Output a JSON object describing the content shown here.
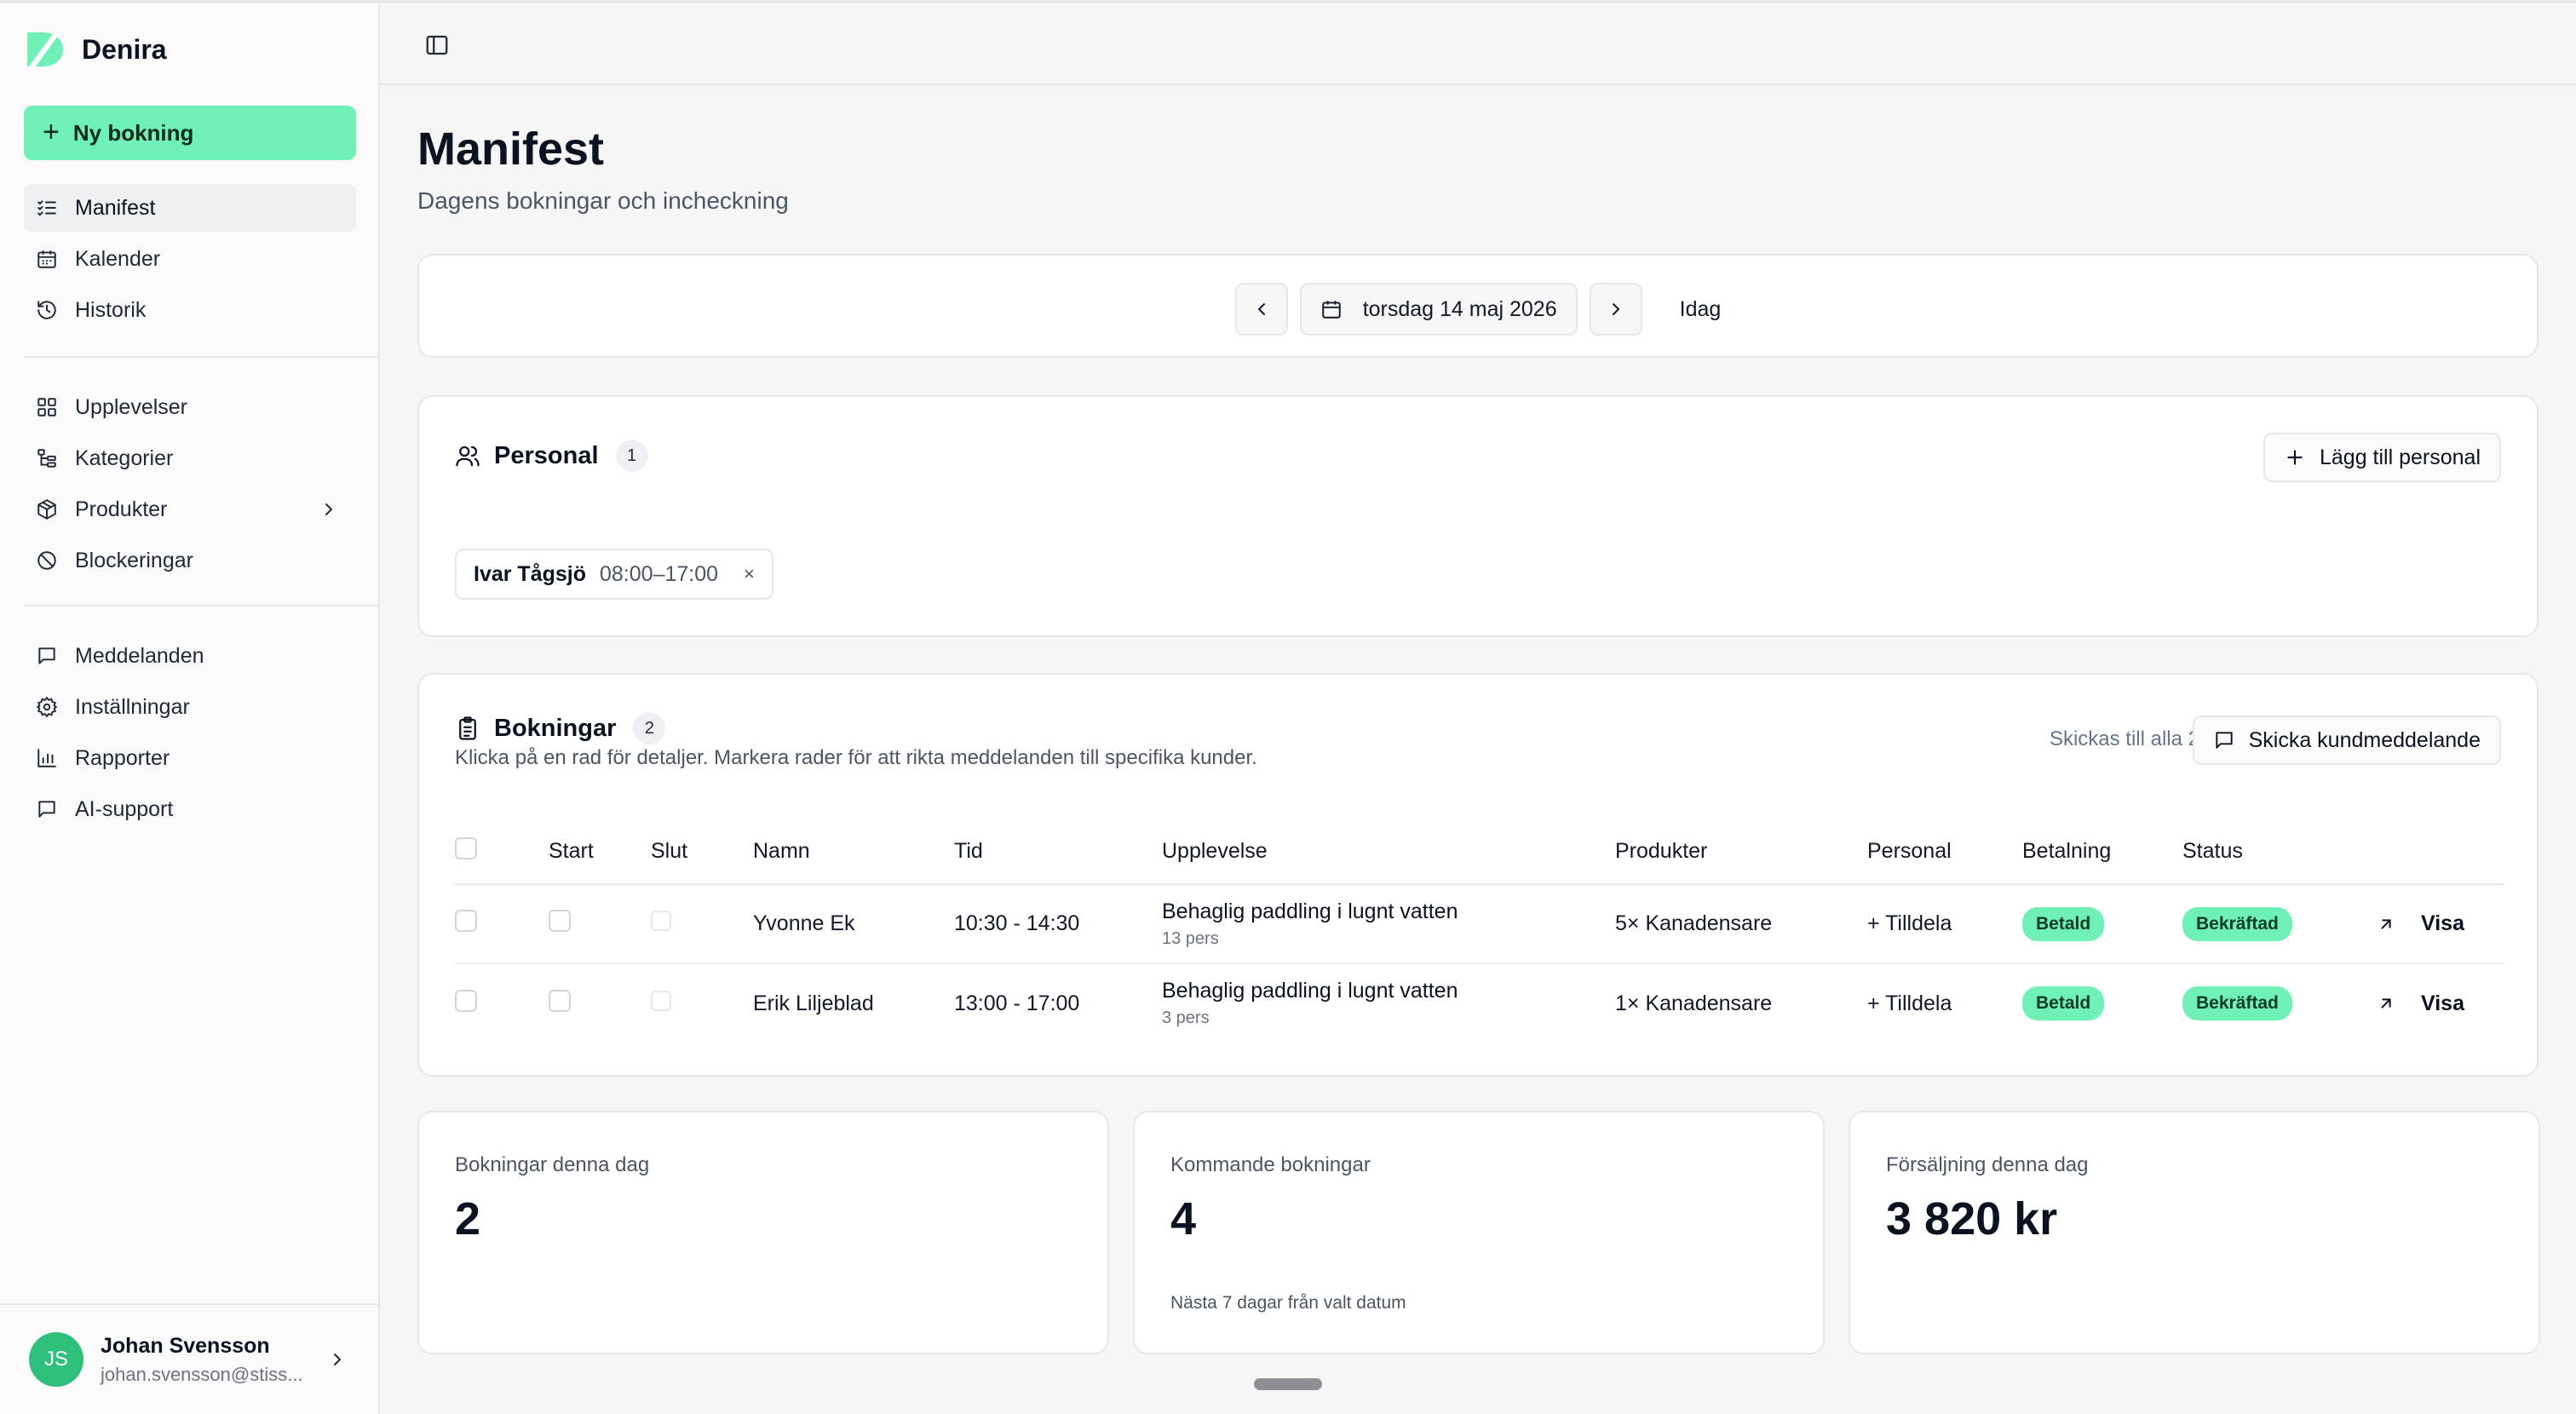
{
  "app": {
    "brand": "Denira",
    "accent": "#6ef0b6"
  },
  "sidebar": {
    "new_booking": "Ny bokning",
    "groups": [
      [
        {
          "label": "Manifest",
          "icon": "list-check-icon",
          "active": true
        },
        {
          "label": "Kalender",
          "icon": "calendar-icon"
        },
        {
          "label": "Historik",
          "icon": "history-icon"
        }
      ],
      [
        {
          "label": "Upplevelser",
          "icon": "grid-icon"
        },
        {
          "label": "Kategorier",
          "icon": "tree-icon"
        },
        {
          "label": "Produkter",
          "icon": "box-icon",
          "has_children": true
        },
        {
          "label": "Blockeringar",
          "icon": "ban-icon"
        }
      ],
      [
        {
          "label": "Meddelanden",
          "icon": "message-icon"
        },
        {
          "label": "Inställningar",
          "icon": "gear-icon"
        },
        {
          "label": "Rapporter",
          "icon": "bar-chart-icon"
        },
        {
          "label": "AI-support",
          "icon": "message-icon"
        }
      ]
    ],
    "user": {
      "initials": "JS",
      "name": "Johan Svensson",
      "email": "johan.svensson@stiss..."
    }
  },
  "page": {
    "title": "Manifest",
    "subtitle": "Dagens bokningar och incheckning"
  },
  "date_nav": {
    "date": "torsdag 14 maj 2026",
    "today": "Idag"
  },
  "staff": {
    "title": "Personal",
    "count": "1",
    "add_label": "Lägg till personal",
    "chips": [
      {
        "name": "Ivar Tågsjö",
        "time": "08:00–17:00",
        "remove": "×"
      }
    ]
  },
  "bookings": {
    "title": "Bokningar",
    "count": "2",
    "description": "Klicka på en rad för detaljer. Markera rader för att rikta meddelanden till specifika kunder.",
    "send_to": "Skickas till alla 2",
    "send_label": "Skicka kundmeddelande",
    "columns": [
      "Start",
      "Slut",
      "Namn",
      "Tid",
      "Upplevelse",
      "Produkter",
      "Personal",
      "Betalning",
      "Status"
    ],
    "rows": [
      {
        "name": "Yvonne Ek",
        "time": "10:30 - 14:30",
        "experience": "Behaglig paddling i lugnt vatten",
        "people": "13 pers",
        "products": "5× Kanadensare",
        "staff": "+ Tilldela",
        "payment": "Betald",
        "status": "Bekräftad",
        "action": "Visa"
      },
      {
        "name": "Erik Liljeblad",
        "time": "13:00 - 17:00",
        "experience": "Behaglig paddling i lugnt vatten",
        "people": "3 pers",
        "products": "1× Kanadensare",
        "staff": "+ Tilldela",
        "payment": "Betald",
        "status": "Bekräftad",
        "action": "Visa"
      }
    ]
  },
  "stats": [
    {
      "label": "Bokningar denna dag",
      "value": "2",
      "note": ""
    },
    {
      "label": "Kommande bokningar",
      "value": "4",
      "note": "Nästa 7 dagar från valt datum"
    },
    {
      "label": "Försäljning denna dag",
      "value": "3 820 kr",
      "note": ""
    }
  ]
}
